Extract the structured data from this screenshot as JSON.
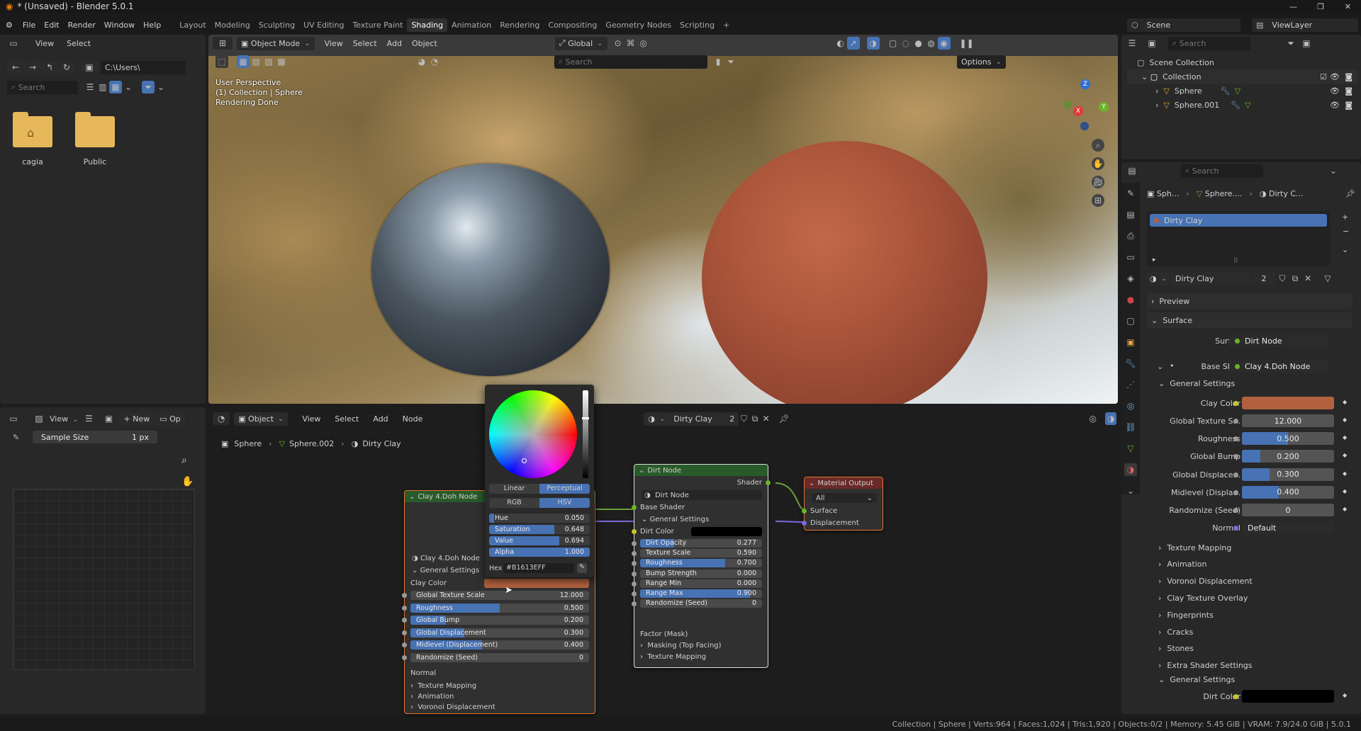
{
  "window": {
    "title": "* (Unsaved) - Blender 5.0.1"
  },
  "menubar": {
    "menus": [
      "File",
      "Edit",
      "Render",
      "Window",
      "Help"
    ],
    "workspaces": [
      "Layout",
      "Modeling",
      "Sculpting",
      "UV Editing",
      "Texture Paint",
      "Shading",
      "Animation",
      "Rendering",
      "Compositing",
      "Geometry Nodes",
      "Scripting"
    ],
    "active_workspace": "Shading",
    "scene": "Scene",
    "view_layer": "ViewLayer"
  },
  "file_browser": {
    "menus": [
      "View",
      "Select"
    ],
    "path": "C:\\Users\\",
    "search_placeholder": "Search",
    "folders": [
      {
        "name": "cagia",
        "icon": "home-folder-icon"
      },
      {
        "name": "Public",
        "icon": "folder-icon"
      }
    ]
  },
  "viewport": {
    "mode": "Object Mode",
    "menus": [
      "View",
      "Select",
      "Add",
      "Object"
    ],
    "orientation": "Global",
    "search_placeholder": "Search",
    "options_label": "Options",
    "overlay_lines": [
      "User Perspective",
      "(1) Collection | Sphere",
      "Rendering Done"
    ],
    "gizmo_axes": [
      "X",
      "Y",
      "Z"
    ]
  },
  "image_editor": {
    "view_label": "View",
    "new_label": "New",
    "open_label": "Op",
    "sample_label": "Sample Size",
    "sample_value": "1 px"
  },
  "node_editor": {
    "mode": "Object",
    "menus": [
      "View",
      "Select",
      "Add",
      "Node"
    ],
    "material": "Dirty Clay",
    "users": "2",
    "breadcrumb": [
      "Sphere",
      "Sphere.002",
      "Dirty Clay"
    ]
  },
  "color_picker": {
    "mode_tabs": [
      "Linear",
      "Perceptual"
    ],
    "active_mode": "Perceptual",
    "model_tabs": [
      "RGB",
      "HSV"
    ],
    "active_model": "HSV",
    "fields": [
      {
        "label": "Hue",
        "value": "0.050",
        "fill": 0.05
      },
      {
        "label": "Saturation",
        "value": "0.648",
        "fill": 0.648
      },
      {
        "label": "Value",
        "value": "0.694",
        "fill": 0.694
      },
      {
        "label": "Alpha",
        "value": "1.000",
        "fill": 1.0
      }
    ],
    "hex_label": "Hex",
    "hex_value": "#B1613EFF"
  },
  "clay_node": {
    "title": "Clay 4.Doh Node",
    "group": "Clay 4.Doh Node",
    "section": "General Settings",
    "clay_color_label": "Clay Color",
    "clay_color": "#b1613e",
    "sliders": [
      {
        "label": "Global Texture Scale",
        "value": "12.000",
        "fill": 0
      },
      {
        "label": "Roughness",
        "value": "0.500",
        "fill": 0.5
      },
      {
        "label": "Global Bump",
        "value": "0.200",
        "fill": 0.2
      },
      {
        "label": "Global Displacement",
        "value": "0.300",
        "fill": 0.3
      },
      {
        "label": "Midlevel (Displacement)",
        "value": "0.400",
        "fill": 0.4
      },
      {
        "label": "Randomize (Seed)",
        "value": "0",
        "fill": 0
      }
    ],
    "normal_label": "Normal",
    "panels": [
      "Texture Mapping",
      "Animation",
      "Voronoi Displacement"
    ]
  },
  "dirt_node": {
    "title": "Dirt Node",
    "output": "Shader",
    "group": "Dirt Node",
    "base_shader": "Base Shader",
    "section": "General Settings",
    "dirt_color_label": "Dirt Color",
    "sliders": [
      {
        "label": "Dirt Opacity",
        "value": "0.277",
        "fill": 0.277
      },
      {
        "label": "Texture Scale",
        "value": "0.590",
        "fill": 0
      },
      {
        "label": "Roughness",
        "value": "0.700",
        "fill": 0.7
      },
      {
        "label": "Bump Strength",
        "value": "0.000",
        "fill": 0
      },
      {
        "label": "Range Min",
        "value": "0.000",
        "fill": 0
      },
      {
        "label": "Range Max",
        "value": "0.900",
        "fill": 0.9
      },
      {
        "label": "Randomize (Seed)",
        "value": "0",
        "fill": 0
      }
    ],
    "factor_label": "Factor (Mask)",
    "panels": [
      "Masking (Top Facing)",
      "Texture Mapping"
    ]
  },
  "output_node": {
    "title": "Material Output",
    "target": "All",
    "inputs": [
      "Surface",
      "Displacement"
    ]
  },
  "outliner": {
    "search_placeholder": "Search",
    "root": "Scene Collection",
    "collection": "Collection",
    "objects": [
      "Sphere",
      "Sphere.001"
    ]
  },
  "properties": {
    "search_placeholder": "Search",
    "breadcrumb": [
      "Sph...",
      "Sphere....",
      "Dirty C..."
    ],
    "slot": "Dirty Clay",
    "material": "Dirty Clay",
    "users": "2",
    "preview_label": "Preview",
    "surface_section": "Surface",
    "surface_label": "Surface",
    "surface_value": "Dirt Node",
    "base_shader_label": "Base Sha...",
    "base_shader_value": "Clay 4.Doh Node",
    "general_section": "General Settings",
    "clay_color_label": "Clay Color",
    "rows": [
      {
        "label": "Global Texture S...",
        "value": "12.000",
        "fill": 0
      },
      {
        "label": "Roughness",
        "value": "0.500",
        "fill": 0.5
      },
      {
        "label": "Global Bump",
        "value": "0.200",
        "fill": 0.2
      },
      {
        "label": "Global Displace...",
        "value": "0.300",
        "fill": 0.3
      },
      {
        "label": "Midlevel (Displa...",
        "value": "0.400",
        "fill": 0.4
      },
      {
        "label": "Randomize (Seed)",
        "value": "0",
        "fill": 0
      }
    ],
    "normal_label": "Normal",
    "normal_value": "Default",
    "panels": [
      "Texture Mapping",
      "Animation",
      "Voronoi Displacement",
      "Clay Texture Overlay",
      "Fingerprints",
      "Cracks",
      "Stones",
      "Extra Shader Settings"
    ],
    "general_section2": "General Settings",
    "dirt_color_label": "Dirt Color"
  },
  "statusbar": {
    "text": "Collection | Sphere | Verts:964 | Faces:1,024 | Tris:1,920 | Objects:0/2 | Memory: 5.45 GiB | VRAM: 7.9/24.0 GiB | 5.0.1"
  }
}
